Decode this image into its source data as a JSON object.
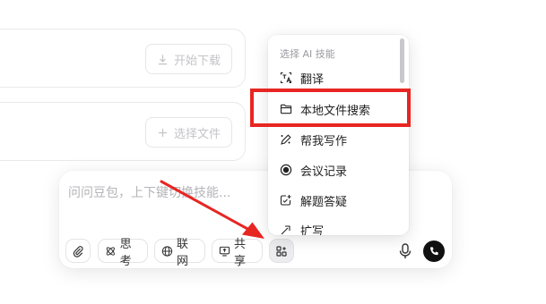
{
  "cards": {
    "download": {
      "button_label": "开始下载",
      "icon": "download-icon"
    },
    "upload": {
      "button_label": "选择文件",
      "icon": "plus-icon"
    }
  },
  "composer": {
    "placeholder": "问问豆包，上下键切换技能...",
    "toolbar": {
      "attach_icon": "paperclip-icon",
      "think_label": "思考",
      "web_label": "联网",
      "share_label": "共享",
      "skills_icon": "apps-grid-icon"
    },
    "mic_icon": "microphone-icon",
    "call_icon": "phone-icon"
  },
  "skill_menu": {
    "title": "选择 AI 技能",
    "items": [
      {
        "label": "翻译",
        "icon": "translate-icon"
      },
      {
        "label": "本地文件搜索",
        "icon": "folder-icon",
        "highlighted": true
      },
      {
        "label": "帮我写作",
        "icon": "pen-icon"
      },
      {
        "label": "会议记录",
        "icon": "record-icon"
      },
      {
        "label": "解题答疑",
        "icon": "answer-icon"
      },
      {
        "label": "扩写",
        "icon": "expand-icon"
      }
    ]
  },
  "annotation": {
    "highlight_color": "#e72622",
    "arrow_color": "#e72622"
  }
}
